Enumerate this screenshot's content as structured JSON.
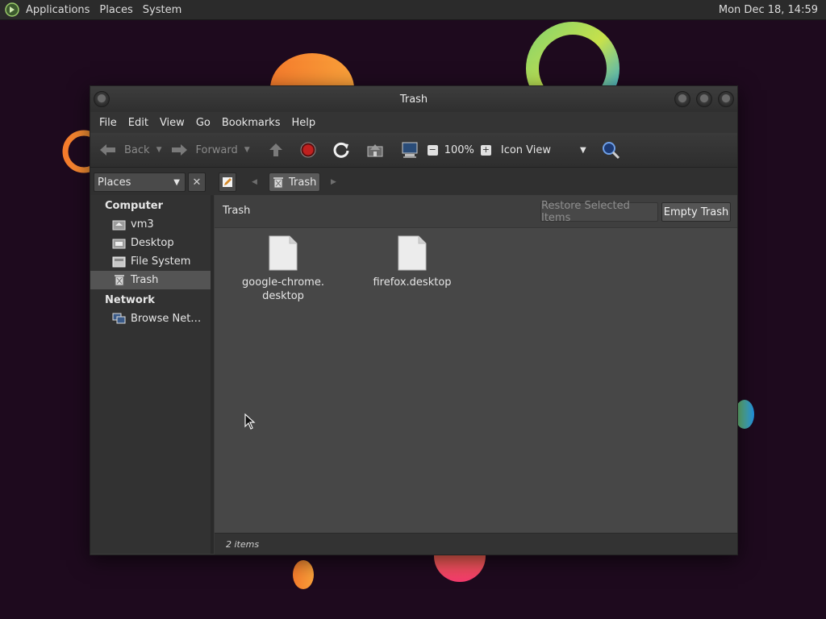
{
  "topbar": {
    "menus": [
      "Applications",
      "Places",
      "System"
    ],
    "clock": "Mon Dec 18, 14:59"
  },
  "window": {
    "title": "Trash",
    "menu": [
      "File",
      "Edit",
      "View",
      "Go",
      "Bookmarks",
      "Help"
    ],
    "toolbar": {
      "back": "Back",
      "forward": "Forward",
      "zoom": "100%",
      "view_mode": "Icon View"
    },
    "location": {
      "places_combo": "Places",
      "crumb": "Trash"
    },
    "sidebar": {
      "sections": [
        {
          "heading": "Computer",
          "items": [
            "vm3",
            "Desktop",
            "File System",
            "Trash"
          ]
        },
        {
          "heading": "Network",
          "items": [
            "Browse Net…"
          ]
        }
      ],
      "selected": "Trash"
    },
    "infobar": {
      "title": "Trash",
      "restore_label": "Restore Selected Items",
      "empty_label": "Empty Trash"
    },
    "files": [
      {
        "line1": "google-chrome.",
        "line2": "desktop"
      },
      {
        "line1": "firefox.desktop",
        "line2": ""
      }
    ],
    "status": "2 items"
  }
}
